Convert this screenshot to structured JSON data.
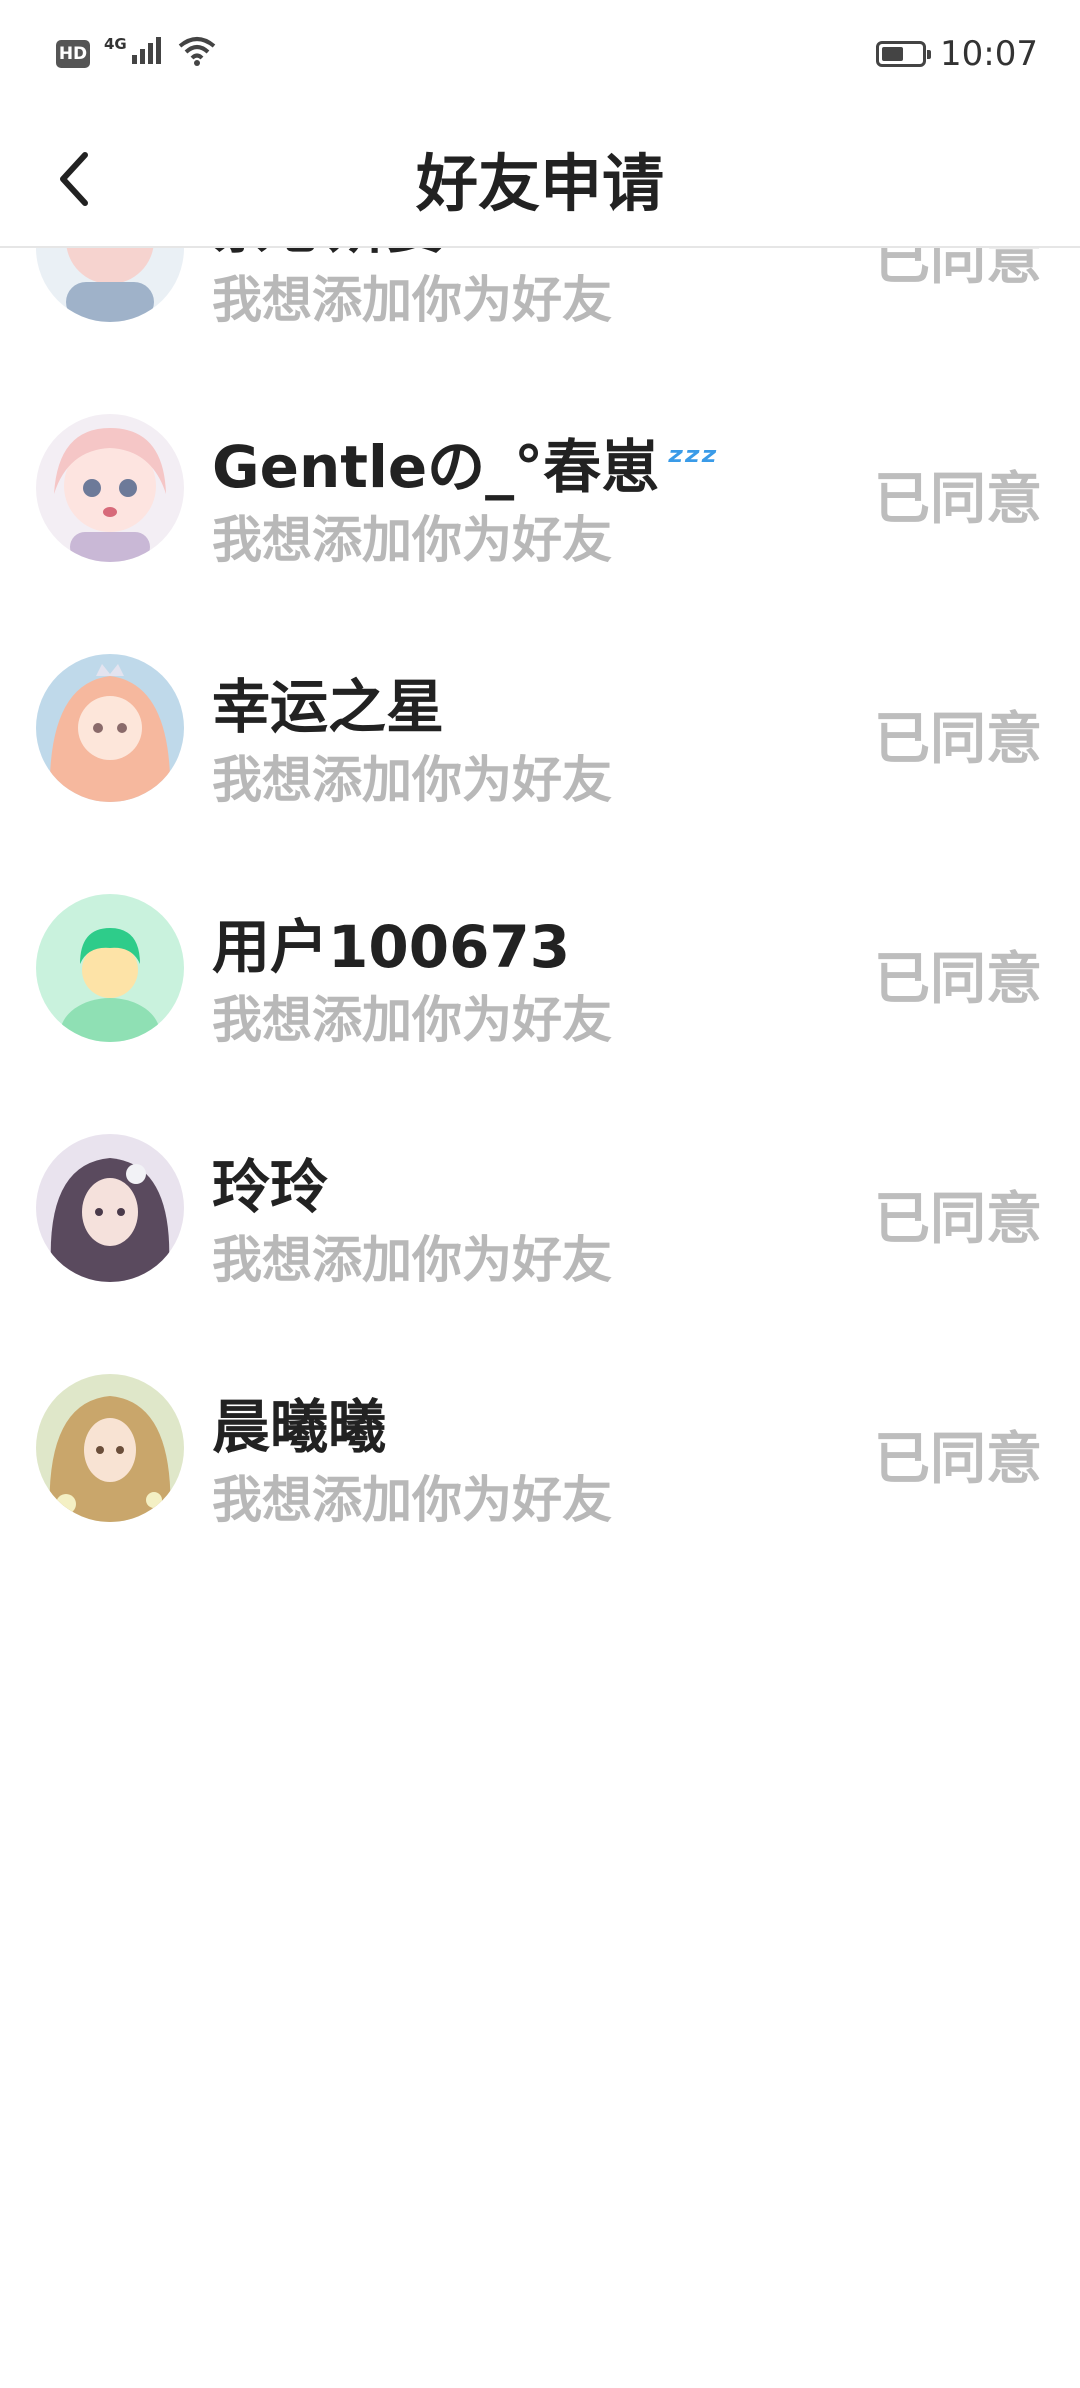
{
  "status_bar": {
    "hd_badge": "HD",
    "network": "4G",
    "time": "10:07",
    "battery_level": 0.55
  },
  "header": {
    "title": "好友申请",
    "back_icon": "chevron-left-icon"
  },
  "requests": [
    {
      "name": "柰芯妍要",
      "message": "我想添加你为好友",
      "status": "已同意",
      "avatar_colors": [
        "#f6d3cf",
        "#9fb2c9"
      ]
    },
    {
      "name": "Gentleの_°春崽",
      "message": "我想添加你为好友",
      "status": "已同意",
      "avatar_colors": [
        "#f5d6d8",
        "#c9b8d6"
      ]
    },
    {
      "name": "幸运之星",
      "message": "我想添加你为好友",
      "status": "已同意",
      "avatar_colors": [
        "#f8c9b5",
        "#bfd9ea"
      ]
    },
    {
      "name": "用户100673",
      "message": "我想添加你为好友",
      "status": "已同意",
      "avatar_colors": [
        "#c9f2dd",
        "#2ecc8a"
      ]
    },
    {
      "name": "玲玲",
      "message": "我想添加你为好友",
      "status": "已同意",
      "avatar_colors": [
        "#e9e3ee",
        "#5a4a5e"
      ]
    },
    {
      "name": "晨曦曦",
      "message": "我想添加你为好友",
      "status": "已同意",
      "avatar_colors": [
        "#f2e2b6",
        "#c9a66b"
      ]
    }
  ],
  "colors": {
    "name_text": "#222222",
    "secondary_text": "#b8b8b8",
    "status_text": "#bdbdbd",
    "divider": "#e6e6e6"
  }
}
